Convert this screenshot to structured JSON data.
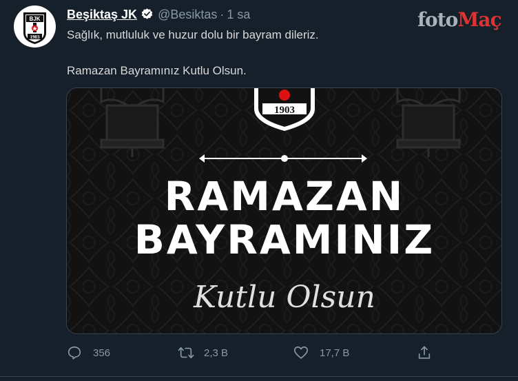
{
  "tweet": {
    "author_name": "Beşiktaş JK",
    "handle": "@Besiktas",
    "separator": "·",
    "time": "1 sa",
    "line1": "Sağlık, mutluluk ve huzur dolu bir bayram dileriz.",
    "line2": "Ramazan Bayramınız Kutlu Olsun."
  },
  "avatar": {
    "logo_year": "1903",
    "logo_letters": "BJK",
    "icon": "bjk-crest-icon"
  },
  "watermark": {
    "part1": "foto",
    "part2": "Maç"
  },
  "media": {
    "emblem_year": "1903",
    "title_line1": "RAMAZAN",
    "title_line2": "BAYRAMINIZ",
    "script_text": "Kutlu Olsun",
    "background_color": "#121212"
  },
  "actions": {
    "reply": {
      "icon": "reply-icon",
      "count": "356"
    },
    "retweet": {
      "icon": "retweet-icon",
      "count": "2,3 B"
    },
    "like": {
      "icon": "heart-icon",
      "count": "17,7 B"
    },
    "share": {
      "icon": "share-icon"
    }
  },
  "colors": {
    "background": "#15202b",
    "text": "#d9d9d9",
    "muted": "#8899a6",
    "verified": "#ffffff",
    "watermark_red": "#dd3333"
  }
}
